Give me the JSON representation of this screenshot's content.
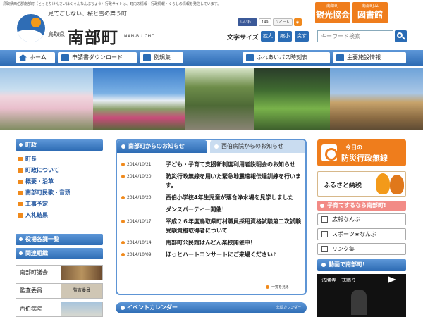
{
  "header": {
    "topline": "鳥取県西伯郡南部町（とっとりけんさいはくぐんなんぶちょう）行政サイトは、町内の情報・行政情報・くらしの情報を発信しています。",
    "tagline": "見てごしない、桜と雪の舞う町",
    "prefecture": "鳥取県",
    "town_name": "南部町",
    "town_roman": "NAN-BU CHO",
    "social": {
      "facebook_label": "いいね！",
      "facebook_count": "149",
      "tweet_label": "ツイート",
      "rss_label": "rss"
    },
    "badges": [
      {
        "small": "南部町",
        "large": "観光協会"
      },
      {
        "small": "南部町立",
        "large": "図書館"
      }
    ],
    "font_size": {
      "label": "文字サイズ",
      "buttons": [
        "拡大",
        "縮小",
        "戻す"
      ]
    },
    "search": {
      "placeholder": "キーワード検索",
      "icon": "search-icon"
    }
  },
  "nav": {
    "items": [
      {
        "label": "ホーム",
        "icon": "home-icon"
      },
      {
        "label": "申請書ダウンロード",
        "icon": "document-icon"
      },
      {
        "label": "例規集",
        "icon": "book-icon"
      },
      {
        "label": "ふれあいバス時刻表",
        "icon": "bus-icon"
      },
      {
        "label": "主要施設情報",
        "icon": "phone-icon"
      }
    ]
  },
  "sidebar": {
    "gov_heading": "町政",
    "gov_items": [
      "町長",
      "町政について",
      "概要・沿革",
      "南部町民歌・音頭",
      "工事予定",
      "入札結果"
    ],
    "dept_heading": "役場各課一覧",
    "org_heading": "関連組織",
    "org_items": [
      "南部町議会",
      "監査委員",
      "西伯病院"
    ],
    "audit_thumb_label": "監査委員"
  },
  "news": {
    "tab_active": "南部町からのお知らせ",
    "tab_other": "西伯病院からのお知らせ",
    "items": [
      {
        "date": "2014/10/21",
        "title": "子ども・子育て支援新制度利用者説明会のお知らせ"
      },
      {
        "date": "2014/10/20",
        "title": "防災行政無線を用いた緊急地震速報伝達訓練を行います。"
      },
      {
        "date": "2014/10/20",
        "title": "西伯小学校4年生児童が落合浄水場を見学しました"
      },
      {
        "date": "",
        "title": "ダンスパーティー開催！"
      },
      {
        "date": "2014/10/17",
        "title": "平成２６年度鳥取県町村職員採用資格試験第二次試験受験資格取得者について"
      },
      {
        "date": "2014/10/14",
        "title": "南部町公民館はんどん楽校開催中！"
      },
      {
        "date": "2014/10/09",
        "title": "ほっとハートコンサートにご来場ください♪"
      }
    ],
    "more_label": "一覧を見る"
  },
  "event": {
    "heading": "イベントカレンダー",
    "sub": "年間カレンダー"
  },
  "right": {
    "bousai_small": "今日の",
    "bousai_large": "防災行政無線",
    "furusato": "ふるさと納税",
    "kosodate": "子育てするなら南部町!",
    "links": [
      {
        "label": "広報なんぶ",
        "icon": "newspaper-icon"
      },
      {
        "label": "スポーツ★なんぶ",
        "icon": "sports-icon"
      },
      {
        "label": "リンク集",
        "icon": "link-icon"
      }
    ],
    "video_heading": "動画で南部町!",
    "video_title": "法勝寺一式飾り"
  },
  "colors": {
    "brand_blue": "#2e6cb4",
    "accent_orange": "#ef7d1c",
    "pink": "#f28b86"
  }
}
